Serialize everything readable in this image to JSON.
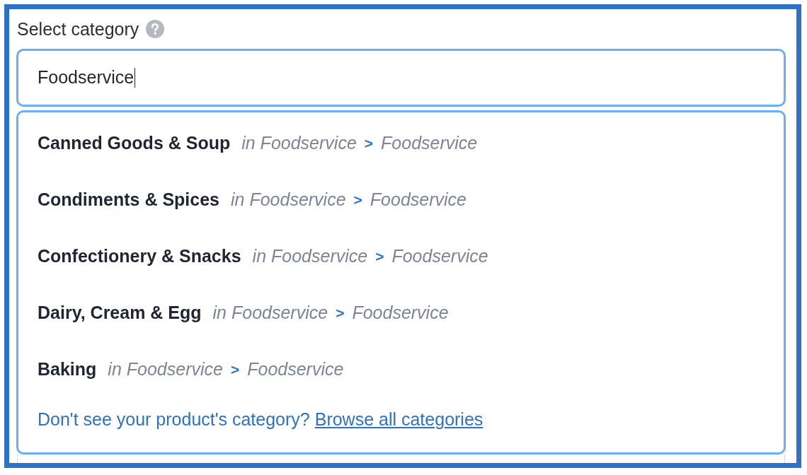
{
  "field": {
    "label": "Select category",
    "value": "Foodservice",
    "focused": true
  },
  "suggestions": [
    {
      "name": "Canned Goods & Soup",
      "context": "in Foodservice",
      "separator": ">",
      "category": "Foodservice",
      "selected": false
    },
    {
      "name": "Condiments & Spices",
      "context": "in Foodservice",
      "separator": ">",
      "category": "Foodservice",
      "selected": false
    },
    {
      "name": "Confectionery & Snacks",
      "context": "in Foodservice",
      "separator": ">",
      "category": "Foodservice",
      "selected": false
    },
    {
      "name": "Dairy, Cream & Egg",
      "context": "in Foodservice",
      "separator": ">",
      "category": "Foodservice",
      "selected": false
    },
    {
      "name": "Baking",
      "context": "in Foodservice",
      "separator": ">",
      "category": "Foodservice",
      "selected": false
    }
  ],
  "footer": {
    "text": "Don't see your product's category?",
    "link": "Browse all categories"
  }
}
